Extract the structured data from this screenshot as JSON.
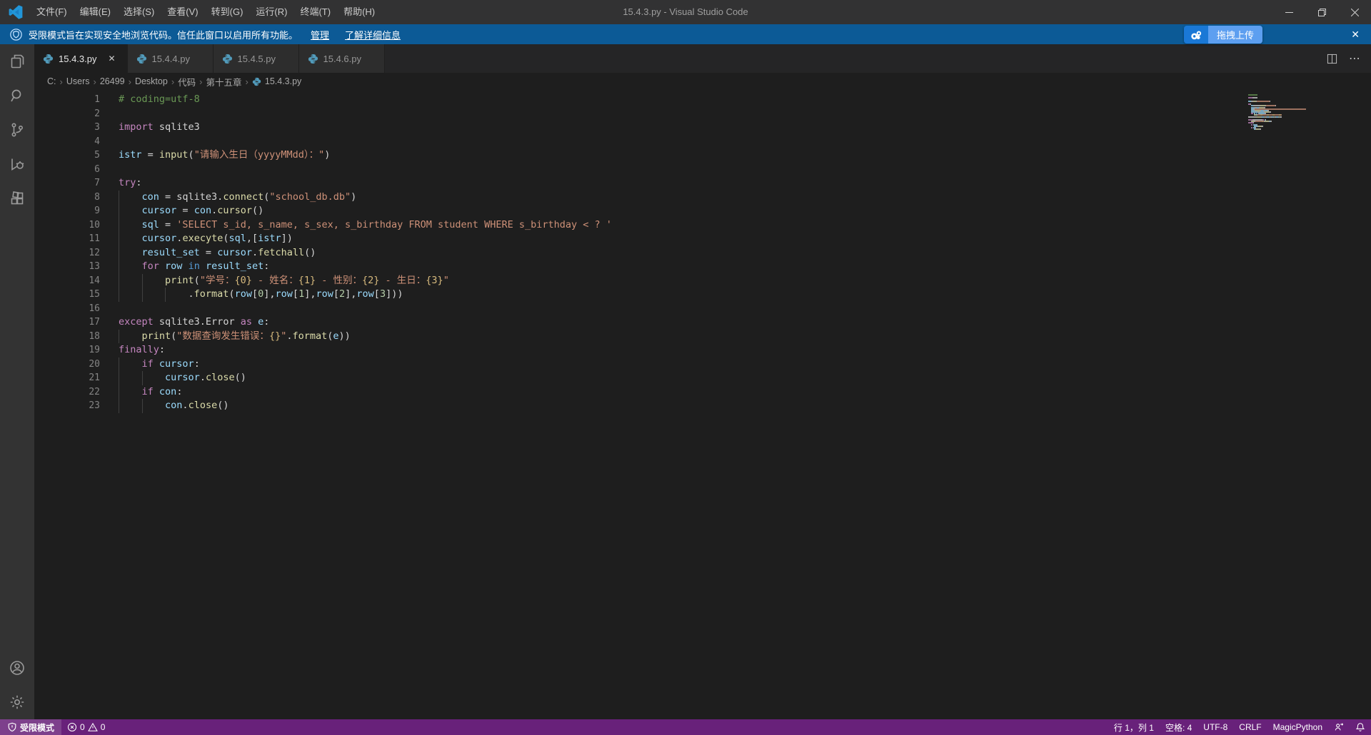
{
  "window": {
    "title": "15.4.3.py - Visual Studio Code",
    "minimize": "–",
    "close_glyph": "✕"
  },
  "menu": {
    "items": [
      "文件(F)",
      "编辑(E)",
      "选择(S)",
      "查看(V)",
      "转到(G)",
      "运行(R)",
      "终端(T)",
      "帮助(H)"
    ]
  },
  "banner": {
    "message": "受限模式旨在实现安全地浏览代码。信任此窗口以启用所有功能。",
    "manage": "管理",
    "learn_more": "了解详细信息",
    "upload_button": "拖拽上传",
    "close_glyph": "✕"
  },
  "activity_bar": {
    "items": [
      "explorer",
      "search",
      "source-control",
      "run-debug",
      "extensions"
    ],
    "bottom_items": [
      "account",
      "settings"
    ]
  },
  "tabs": [
    {
      "label": "15.4.3.py",
      "active": true
    },
    {
      "label": "15.4.4.py",
      "active": false
    },
    {
      "label": "15.4.5.py",
      "active": false
    },
    {
      "label": "15.4.6.py",
      "active": false
    }
  ],
  "breadcrumb": [
    "C:",
    "Users",
    "26499",
    "Desktop",
    "代码",
    "第十五章",
    "15.4.3.py"
  ],
  "editor": {
    "colors": {
      "c": "#6a9955",
      "k": "#c586c0",
      "b": "#569cd6",
      "f": "#dcdcaa",
      "s": "#ce9178",
      "g": "#d7ba7d",
      "v": "#9cdcfe",
      "p": "#d4d4d4",
      "n": "#b5cea8"
    },
    "lines": [
      [
        [
          "c",
          "# coding=utf-8"
        ]
      ],
      [],
      [
        [
          "k",
          "import"
        ],
        [
          "p",
          " sqlite3"
        ]
      ],
      [],
      [
        [
          "v",
          "istr"
        ],
        [
          "p",
          " = "
        ],
        [
          "f",
          "input"
        ],
        [
          "p",
          "("
        ],
        [
          "s",
          "\"请输入生日（yyyyMMdd）："
        ],
        [
          "s",
          "\""
        ],
        [
          "p",
          ")"
        ]
      ],
      [],
      [
        [
          "k",
          "try"
        ],
        [
          "p",
          ":"
        ]
      ],
      [
        [
          "p",
          "    "
        ],
        [
          "v",
          "con"
        ],
        [
          "p",
          " = sqlite3."
        ],
        [
          "f",
          "connect"
        ],
        [
          "p",
          "("
        ],
        [
          "s",
          "\"school_db.db\""
        ],
        [
          "p",
          ")"
        ]
      ],
      [
        [
          "p",
          "    "
        ],
        [
          "v",
          "cursor"
        ],
        [
          "p",
          " = "
        ],
        [
          "v",
          "con"
        ],
        [
          "p",
          "."
        ],
        [
          "f",
          "cursor"
        ],
        [
          "p",
          "()"
        ]
      ],
      [
        [
          "p",
          "    "
        ],
        [
          "v",
          "sql"
        ],
        [
          "p",
          " = "
        ],
        [
          "s",
          "'SELECT s_id, s_name, s_sex, s_birthday FROM student WHERE s_birthday < ? '"
        ]
      ],
      [
        [
          "p",
          "    "
        ],
        [
          "v",
          "cursor"
        ],
        [
          "p",
          "."
        ],
        [
          "f",
          "execyte"
        ],
        [
          "p",
          "("
        ],
        [
          "v",
          "sql"
        ],
        [
          "p",
          ",["
        ],
        [
          "v",
          "istr"
        ],
        [
          "p",
          "])"
        ]
      ],
      [
        [
          "p",
          "    "
        ],
        [
          "v",
          "result_set"
        ],
        [
          "p",
          " = "
        ],
        [
          "v",
          "cursor"
        ],
        [
          "p",
          "."
        ],
        [
          "f",
          "fetchall"
        ],
        [
          "p",
          "()"
        ]
      ],
      [
        [
          "p",
          "    "
        ],
        [
          "k",
          "for"
        ],
        [
          "p",
          " "
        ],
        [
          "v",
          "row"
        ],
        [
          "p",
          " "
        ],
        [
          "b",
          "in"
        ],
        [
          "p",
          " "
        ],
        [
          "v",
          "result_set"
        ],
        [
          "p",
          ":"
        ]
      ],
      [
        [
          "p",
          "        "
        ],
        [
          "f",
          "print"
        ],
        [
          "p",
          "("
        ],
        [
          "s",
          "\"学号："
        ],
        [
          "g",
          "{0}"
        ],
        [
          "s",
          " - 姓名："
        ],
        [
          "g",
          "{1}"
        ],
        [
          "s",
          " - 性别："
        ],
        [
          "g",
          "{2}"
        ],
        [
          "s",
          " - 生日："
        ],
        [
          "g",
          "{3}"
        ],
        [
          "s",
          "\""
        ]
      ],
      [
        [
          "p",
          "            ."
        ],
        [
          "f",
          "format"
        ],
        [
          "p",
          "("
        ],
        [
          "v",
          "row"
        ],
        [
          "p",
          "["
        ],
        [
          "n",
          "0"
        ],
        [
          "p",
          "],"
        ],
        [
          "v",
          "row"
        ],
        [
          "p",
          "["
        ],
        [
          "n",
          "1"
        ],
        [
          "p",
          "],"
        ],
        [
          "v",
          "row"
        ],
        [
          "p",
          "["
        ],
        [
          "n",
          "2"
        ],
        [
          "p",
          "],"
        ],
        [
          "v",
          "row"
        ],
        [
          "p",
          "["
        ],
        [
          "n",
          "3"
        ],
        [
          "p",
          "]))"
        ]
      ],
      [],
      [
        [
          "k",
          "except"
        ],
        [
          "p",
          " sqlite3.Error "
        ],
        [
          "k",
          "as"
        ],
        [
          "p",
          " "
        ],
        [
          "v",
          "e"
        ],
        [
          "p",
          ":"
        ]
      ],
      [
        [
          "p",
          "    "
        ],
        [
          "f",
          "print"
        ],
        [
          "p",
          "("
        ],
        [
          "s",
          "\"数据查询发生错误："
        ],
        [
          "g",
          "{}"
        ],
        [
          "s",
          "\""
        ],
        [
          "p",
          "."
        ],
        [
          "f",
          "format"
        ],
        [
          "p",
          "("
        ],
        [
          "v",
          "e"
        ],
        [
          "p",
          "))"
        ]
      ],
      [
        [
          "k",
          "finally"
        ],
        [
          "p",
          ":"
        ]
      ],
      [
        [
          "p",
          "    "
        ],
        [
          "k",
          "if"
        ],
        [
          "p",
          " "
        ],
        [
          "v",
          "cursor"
        ],
        [
          "p",
          ":"
        ]
      ],
      [
        [
          "p",
          "        "
        ],
        [
          "v",
          "cursor"
        ],
        [
          "p",
          "."
        ],
        [
          "f",
          "close"
        ],
        [
          "p",
          "()"
        ]
      ],
      [
        [
          "p",
          "    "
        ],
        [
          "k",
          "if"
        ],
        [
          "p",
          " "
        ],
        [
          "v",
          "con"
        ],
        [
          "p",
          ":"
        ]
      ],
      [
        [
          "p",
          "        "
        ],
        [
          "v",
          "con"
        ],
        [
          "p",
          "."
        ],
        [
          "f",
          "close"
        ],
        [
          "p",
          "()"
        ]
      ]
    ]
  },
  "status_bar": {
    "restricted": "受限模式",
    "errors": "0",
    "warnings": "0",
    "line_col": "行 1，列 1",
    "spaces": "空格: 4",
    "encoding": "UTF-8",
    "eol": "CRLF",
    "language": "MagicPython"
  }
}
